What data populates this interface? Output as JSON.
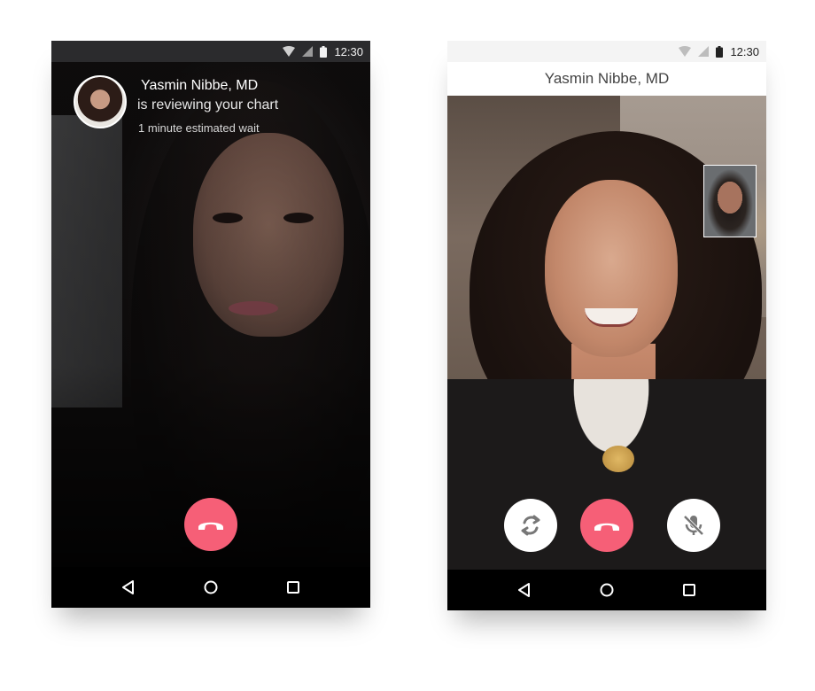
{
  "phone1": {
    "status_time": "12:30",
    "doctor_name": "Yasmin Nibbe, MD",
    "doctor_status": "is reviewing your chart",
    "wait_text": "1 minute estimated wait"
  },
  "phone2": {
    "status_time": "12:30",
    "title": "Yasmin Nibbe, MD"
  },
  "colors": {
    "end_call": "#f65f77",
    "navbar": "#000000"
  },
  "icons": [
    "wifi-icon",
    "signal-icon",
    "battery-icon",
    "end-call-icon",
    "flip-camera-icon",
    "mic-off-icon",
    "back-icon",
    "home-icon",
    "recents-icon"
  ]
}
